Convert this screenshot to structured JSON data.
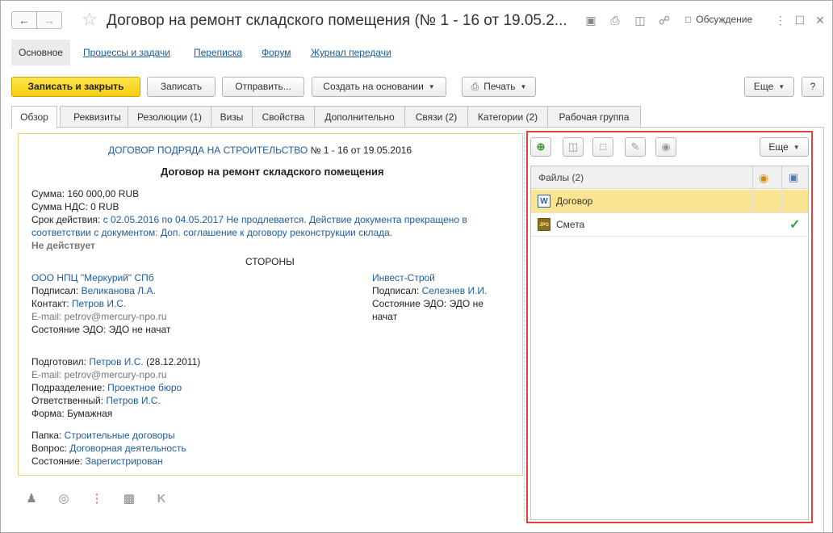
{
  "window": {
    "title": "Договор на ремонт складского помещения (№ 1 - 16 от 19.05.2...",
    "discussion_label": "Обсуждение"
  },
  "section_tabs": [
    {
      "label": "Основное"
    },
    {
      "label": "Процессы и задачи"
    },
    {
      "label": "Переписка"
    },
    {
      "label": "Форум"
    },
    {
      "label": "Журнал передачи"
    }
  ],
  "toolbar": {
    "save_close": "Записать и закрыть",
    "save": "Записать",
    "send": "Отправить...",
    "create_based": "Создать на основании",
    "print": "Печать",
    "more": "Еще",
    "help": "?"
  },
  "tabs": [
    {
      "label": "Обзор"
    },
    {
      "label": "Реквизиты"
    },
    {
      "label": "Резолюции (1)"
    },
    {
      "label": "Визы"
    },
    {
      "label": "Свойства"
    },
    {
      "label": "Дополнительно"
    },
    {
      "label": "Связи (2)"
    },
    {
      "label": "Категории (2)"
    },
    {
      "label": "Рабочая группа"
    }
  ],
  "doc": {
    "type_link": "ДОГОВОР ПОДРЯДА НА СТРОИТЕЛЬСТВО",
    "number": " № 1 - 16 от 19.05.2016",
    "heading": "Договор на ремонт складского помещения",
    "sum_label": "Сумма:",
    "sum_value": " 160 000,00 RUB",
    "vat_label": "Сумма НДС:",
    "vat_value": " 0 RUB",
    "term_label": "Срок действия:",
    "term_line1": " с 02.05.2016 по 04.05.2017 Не продлевается. Действие документа прекращено в",
    "term_line2": "соответствии с документом: Доп. соглашение к договору реконструкции склада.",
    "inactive": "Не действует",
    "parties_heading": "СТОРОНЫ",
    "party1": {
      "name": "ООО НПЦ \"Меркурий\" СПб",
      "signed_label": "Подписал:",
      "signed_value": " Великанова Л.А.",
      "contact_label": "Контакт:",
      "contact_value": " Петров И.С.",
      "email": "E-mail: petrov@mercury-npo.ru",
      "edo": "Состояние ЭДО: ЭДО не начат"
    },
    "party2": {
      "name": "Инвест-Строй",
      "signed_label": "Подписал:",
      "signed_value": " Селезнев И.И.",
      "edo_line1": "Состояние ЭДО: ЭДО не",
      "edo_line2": "начат"
    },
    "prepared_label": "Подготовил:",
    "prepared_value": " Петров И.С.",
    "prepared_date": " (28.12.2011)",
    "prepared_email": "E-mail: petrov@mercury-npo.ru",
    "dept_label": "Подразделение:",
    "dept_value": " Проектное бюро",
    "resp_label": "Ответственный:",
    "resp_value": " Петров И.С.",
    "form_label": "Форма:",
    "form_value": " Бумажная",
    "folder_label": "Папка:",
    "folder_value": " Строительные договоры",
    "question_label": "Вопрос:",
    "question_value": " Договорная деятельность",
    "state_label": "Состояние:",
    "state_value": " Зарегистрирован"
  },
  "files_panel": {
    "more": "Еще",
    "header": "Файлы (2)",
    "rows": [
      {
        "name": "Договор",
        "icon": "W",
        "icon_name": "word-file-icon",
        "selected": true
      },
      {
        "name": "Смета",
        "icon": "JPG",
        "icon_name": "jpg-file-icon",
        "selected": false
      }
    ]
  },
  "colors": {
    "accent_yellow": "#f5cf10",
    "link_blue": "#1f5da0",
    "highlight_border": "#e0423a",
    "selected_row": "#fbe592"
  }
}
